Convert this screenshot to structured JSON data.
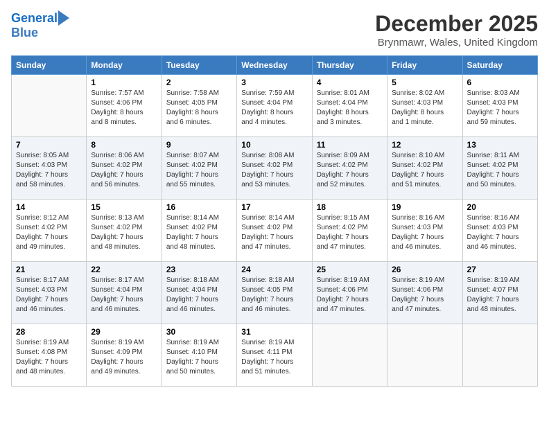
{
  "header": {
    "logo_line1": "General",
    "logo_line2": "Blue",
    "month": "December 2025",
    "location": "Brynmawr, Wales, United Kingdom"
  },
  "weekdays": [
    "Sunday",
    "Monday",
    "Tuesday",
    "Wednesday",
    "Thursday",
    "Friday",
    "Saturday"
  ],
  "weeks": [
    [
      {
        "day": "",
        "info": ""
      },
      {
        "day": "1",
        "info": "Sunrise: 7:57 AM\nSunset: 4:06 PM\nDaylight: 8 hours\nand 8 minutes."
      },
      {
        "day": "2",
        "info": "Sunrise: 7:58 AM\nSunset: 4:05 PM\nDaylight: 8 hours\nand 6 minutes."
      },
      {
        "day": "3",
        "info": "Sunrise: 7:59 AM\nSunset: 4:04 PM\nDaylight: 8 hours\nand 4 minutes."
      },
      {
        "day": "4",
        "info": "Sunrise: 8:01 AM\nSunset: 4:04 PM\nDaylight: 8 hours\nand 3 minutes."
      },
      {
        "day": "5",
        "info": "Sunrise: 8:02 AM\nSunset: 4:03 PM\nDaylight: 8 hours\nand 1 minute."
      },
      {
        "day": "6",
        "info": "Sunrise: 8:03 AM\nSunset: 4:03 PM\nDaylight: 7 hours\nand 59 minutes."
      }
    ],
    [
      {
        "day": "7",
        "info": "Sunrise: 8:05 AM\nSunset: 4:03 PM\nDaylight: 7 hours\nand 58 minutes."
      },
      {
        "day": "8",
        "info": "Sunrise: 8:06 AM\nSunset: 4:02 PM\nDaylight: 7 hours\nand 56 minutes."
      },
      {
        "day": "9",
        "info": "Sunrise: 8:07 AM\nSunset: 4:02 PM\nDaylight: 7 hours\nand 55 minutes."
      },
      {
        "day": "10",
        "info": "Sunrise: 8:08 AM\nSunset: 4:02 PM\nDaylight: 7 hours\nand 53 minutes."
      },
      {
        "day": "11",
        "info": "Sunrise: 8:09 AM\nSunset: 4:02 PM\nDaylight: 7 hours\nand 52 minutes."
      },
      {
        "day": "12",
        "info": "Sunrise: 8:10 AM\nSunset: 4:02 PM\nDaylight: 7 hours\nand 51 minutes."
      },
      {
        "day": "13",
        "info": "Sunrise: 8:11 AM\nSunset: 4:02 PM\nDaylight: 7 hours\nand 50 minutes."
      }
    ],
    [
      {
        "day": "14",
        "info": "Sunrise: 8:12 AM\nSunset: 4:02 PM\nDaylight: 7 hours\nand 49 minutes."
      },
      {
        "day": "15",
        "info": "Sunrise: 8:13 AM\nSunset: 4:02 PM\nDaylight: 7 hours\nand 48 minutes."
      },
      {
        "day": "16",
        "info": "Sunrise: 8:14 AM\nSunset: 4:02 PM\nDaylight: 7 hours\nand 48 minutes."
      },
      {
        "day": "17",
        "info": "Sunrise: 8:14 AM\nSunset: 4:02 PM\nDaylight: 7 hours\nand 47 minutes."
      },
      {
        "day": "18",
        "info": "Sunrise: 8:15 AM\nSunset: 4:02 PM\nDaylight: 7 hours\nand 47 minutes."
      },
      {
        "day": "19",
        "info": "Sunrise: 8:16 AM\nSunset: 4:03 PM\nDaylight: 7 hours\nand 46 minutes."
      },
      {
        "day": "20",
        "info": "Sunrise: 8:16 AM\nSunset: 4:03 PM\nDaylight: 7 hours\nand 46 minutes."
      }
    ],
    [
      {
        "day": "21",
        "info": "Sunrise: 8:17 AM\nSunset: 4:03 PM\nDaylight: 7 hours\nand 46 minutes."
      },
      {
        "day": "22",
        "info": "Sunrise: 8:17 AM\nSunset: 4:04 PM\nDaylight: 7 hours\nand 46 minutes."
      },
      {
        "day": "23",
        "info": "Sunrise: 8:18 AM\nSunset: 4:04 PM\nDaylight: 7 hours\nand 46 minutes."
      },
      {
        "day": "24",
        "info": "Sunrise: 8:18 AM\nSunset: 4:05 PM\nDaylight: 7 hours\nand 46 minutes."
      },
      {
        "day": "25",
        "info": "Sunrise: 8:19 AM\nSunset: 4:06 PM\nDaylight: 7 hours\nand 47 minutes."
      },
      {
        "day": "26",
        "info": "Sunrise: 8:19 AM\nSunset: 4:06 PM\nDaylight: 7 hours\nand 47 minutes."
      },
      {
        "day": "27",
        "info": "Sunrise: 8:19 AM\nSunset: 4:07 PM\nDaylight: 7 hours\nand 48 minutes."
      }
    ],
    [
      {
        "day": "28",
        "info": "Sunrise: 8:19 AM\nSunset: 4:08 PM\nDaylight: 7 hours\nand 48 minutes."
      },
      {
        "day": "29",
        "info": "Sunrise: 8:19 AM\nSunset: 4:09 PM\nDaylight: 7 hours\nand 49 minutes."
      },
      {
        "day": "30",
        "info": "Sunrise: 8:19 AM\nSunset: 4:10 PM\nDaylight: 7 hours\nand 50 minutes."
      },
      {
        "day": "31",
        "info": "Sunrise: 8:19 AM\nSunset: 4:11 PM\nDaylight: 7 hours\nand 51 minutes."
      },
      {
        "day": "",
        "info": ""
      },
      {
        "day": "",
        "info": ""
      },
      {
        "day": "",
        "info": ""
      }
    ]
  ]
}
